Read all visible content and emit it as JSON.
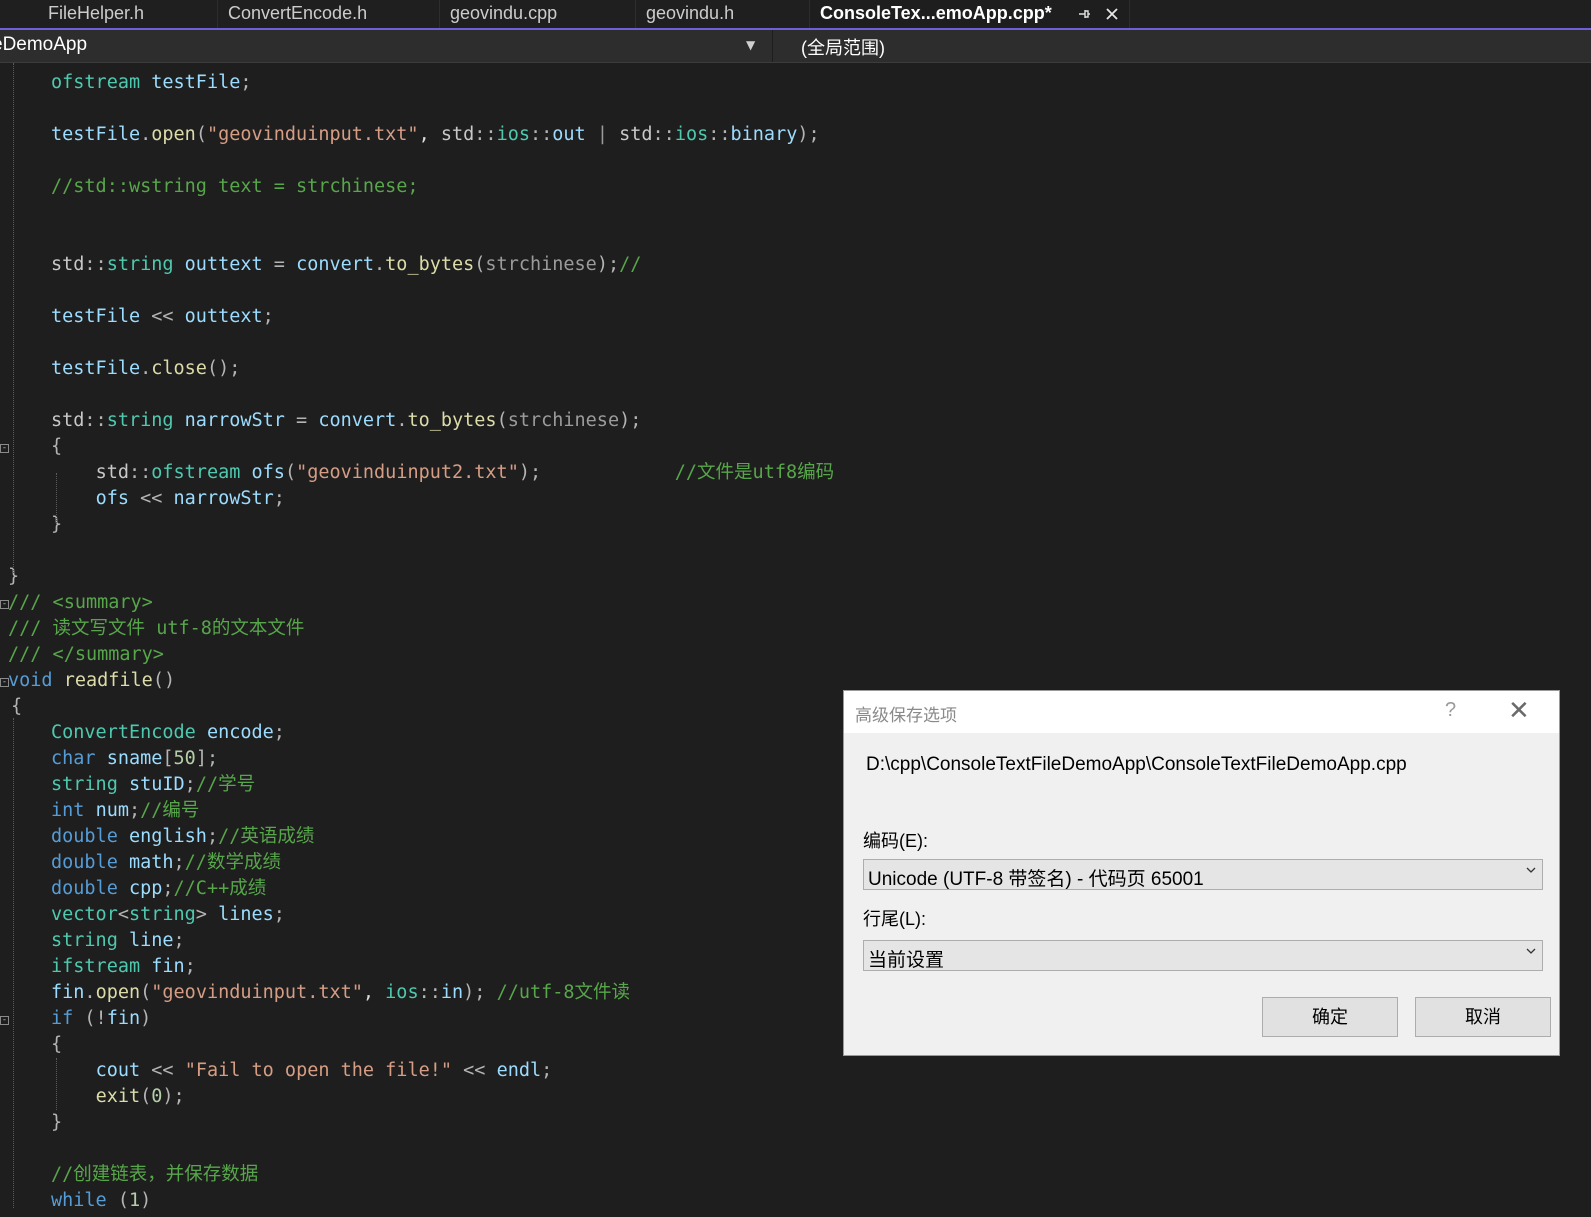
{
  "tabs": [
    {
      "label": "FileHelper.h"
    },
    {
      "label": "ConvertEncode.h"
    },
    {
      "label": "geovindu.cpp"
    },
    {
      "label": "geovindu.h"
    },
    {
      "label": "ConsoleTex...emoApp.cpp*",
      "active": true
    }
  ],
  "tab_icons": {
    "pin": "pin-icon",
    "close": "close-icon"
  },
  "navbar": {
    "project": "eDemoApp",
    "scope": "(全局范围)"
  },
  "code_lines": [
    [
      [
        "ofstream",
        "ty"
      ],
      [
        " ",
        ""
      ],
      [
        "testFile",
        "vr"
      ],
      [
        ";",
        "op"
      ]
    ],
    [],
    [
      [
        "testFile",
        "vr"
      ],
      [
        ".",
        "op"
      ],
      [
        "open",
        "fn"
      ],
      [
        "(",
        "op"
      ],
      [
        "\"geovinduinput.txt\"",
        "st"
      ],
      [
        ", ",
        ""
      ],
      [
        "std",
        "ns"
      ],
      [
        "::",
        "op"
      ],
      [
        "ios",
        "ty"
      ],
      [
        "::",
        "op"
      ],
      [
        "out",
        "vr"
      ],
      [
        " | ",
        "gr"
      ],
      [
        "std",
        "ns"
      ],
      [
        "::",
        "op"
      ],
      [
        "ios",
        "ty"
      ],
      [
        "::",
        "op"
      ],
      [
        "binary",
        "vr"
      ],
      [
        ");",
        "op"
      ]
    ],
    [],
    [
      [
        "//std::wstring text = strchinese;",
        "cm"
      ]
    ],
    [],
    [],
    [
      [
        "std",
        "ns"
      ],
      [
        "::",
        "op"
      ],
      [
        "string",
        "ty"
      ],
      [
        " ",
        ""
      ],
      [
        "outtext",
        "vr"
      ],
      [
        " = ",
        "op"
      ],
      [
        "convert",
        "vr"
      ],
      [
        ".",
        "op"
      ],
      [
        "to_bytes",
        "fn"
      ],
      [
        "(",
        "op"
      ],
      [
        "strchinese",
        "gr"
      ],
      [
        ");",
        "op"
      ],
      [
        "//",
        "cm"
      ]
    ],
    [],
    [
      [
        "testFile",
        "vr"
      ],
      [
        " << ",
        "op"
      ],
      [
        "outtext",
        "vr"
      ],
      [
        ";",
        "op"
      ]
    ],
    [],
    [
      [
        "testFile",
        "vr"
      ],
      [
        ".",
        "op"
      ],
      [
        "close",
        "fn"
      ],
      [
        "();",
        "op"
      ]
    ],
    [],
    [
      [
        "std",
        "ns"
      ],
      [
        "::",
        "op"
      ],
      [
        "string",
        "ty"
      ],
      [
        " ",
        ""
      ],
      [
        "narrowStr",
        "vr"
      ],
      [
        " = ",
        "op"
      ],
      [
        "convert",
        "vr"
      ],
      [
        ".",
        "op"
      ],
      [
        "to_bytes",
        "fn"
      ],
      [
        "(",
        "op"
      ],
      [
        "strchinese",
        "gr"
      ],
      [
        ");",
        "op"
      ]
    ],
    [
      [
        "{",
        "op"
      ]
    ],
    [
      [
        "    ",
        ""
      ],
      [
        "std",
        "ns"
      ],
      [
        "::",
        "op"
      ],
      [
        "ofstream",
        "ty"
      ],
      [
        " ",
        ""
      ],
      [
        "ofs",
        "vr"
      ],
      [
        "(",
        "op"
      ],
      [
        "\"geovinduinput2.txt\"",
        "st"
      ],
      [
        ");",
        "op"
      ],
      [
        "            ",
        ""
      ],
      [
        "//文件是utf8编码",
        "cm"
      ]
    ],
    [
      [
        "    ",
        ""
      ],
      [
        "ofs",
        "vr"
      ],
      [
        " << ",
        "op"
      ],
      [
        "narrowStr",
        "vr"
      ],
      [
        ";",
        "op"
      ]
    ],
    [
      [
        "}",
        "op"
      ]
    ],
    [],
    [
      [
        "}",
        "op"
      ]
    ],
    [
      [
        "/// <summary>",
        "cm"
      ]
    ],
    [
      [
        "/// 读文写文件 utf-8的文本文件",
        "cm"
      ]
    ],
    [
      [
        "/// </summary>",
        "cm"
      ]
    ],
    [
      [
        "void",
        "kw"
      ],
      [
        " ",
        ""
      ],
      [
        "readfile",
        "fn"
      ],
      [
        "()",
        "op"
      ]
    ],
    [
      [
        "{",
        "op"
      ]
    ],
    [
      [
        "ConvertEncode",
        "ty"
      ],
      [
        " ",
        ""
      ],
      [
        "encode",
        "vr"
      ],
      [
        ";",
        "op"
      ]
    ],
    [
      [
        "char",
        "kw"
      ],
      [
        " ",
        ""
      ],
      [
        "sname",
        "vr"
      ],
      [
        "[",
        "op"
      ],
      [
        "50",
        "nm"
      ],
      [
        "];",
        "op"
      ]
    ],
    [
      [
        "string",
        "ty"
      ],
      [
        " ",
        ""
      ],
      [
        "stuID",
        "vr"
      ],
      [
        ";",
        "op"
      ],
      [
        "//学号",
        "cm"
      ]
    ],
    [
      [
        "int",
        "kw"
      ],
      [
        " ",
        ""
      ],
      [
        "num",
        "vr"
      ],
      [
        ";",
        "op"
      ],
      [
        "//编号",
        "cm"
      ]
    ],
    [
      [
        "double",
        "kw"
      ],
      [
        " ",
        ""
      ],
      [
        "english",
        "vr"
      ],
      [
        ";",
        "op"
      ],
      [
        "//英语成绩",
        "cm"
      ]
    ],
    [
      [
        "double",
        "kw"
      ],
      [
        " ",
        ""
      ],
      [
        "math",
        "vr"
      ],
      [
        ";",
        "op"
      ],
      [
        "//数学成绩",
        "cm"
      ]
    ],
    [
      [
        "double",
        "kw"
      ],
      [
        " ",
        ""
      ],
      [
        "cpp",
        "vr"
      ],
      [
        ";",
        "op"
      ],
      [
        "//C++成绩",
        "cm"
      ]
    ],
    [
      [
        "vector",
        "ty"
      ],
      [
        "<",
        "op"
      ],
      [
        "string",
        "ty"
      ],
      [
        "> ",
        "op"
      ],
      [
        "lines",
        "vr"
      ],
      [
        ";",
        "op"
      ]
    ],
    [
      [
        "string",
        "ty"
      ],
      [
        " ",
        ""
      ],
      [
        "line",
        "vr"
      ],
      [
        ";",
        "op"
      ]
    ],
    [
      [
        "ifstream",
        "ty"
      ],
      [
        " ",
        ""
      ],
      [
        "fin",
        "vr"
      ],
      [
        ";",
        "op"
      ]
    ],
    [
      [
        "fin",
        "vr"
      ],
      [
        ".",
        "op"
      ],
      [
        "open",
        "fn"
      ],
      [
        "(",
        "op"
      ],
      [
        "\"geovinduinput.txt\"",
        "st"
      ],
      [
        ", ",
        ""
      ],
      [
        "ios",
        "ty"
      ],
      [
        "::",
        "op"
      ],
      [
        "in",
        "vr"
      ],
      [
        "); ",
        "op"
      ],
      [
        "//utf-8文件读",
        "cm"
      ]
    ],
    [
      [
        "if",
        "kw"
      ],
      [
        " (!",
        "op"
      ],
      [
        "fin",
        "vr"
      ],
      [
        ")",
        "op"
      ]
    ],
    [
      [
        "{",
        "op"
      ]
    ],
    [
      [
        "    ",
        ""
      ],
      [
        "cout",
        "vr"
      ],
      [
        " << ",
        "op"
      ],
      [
        "\"Fail to open the file!\"",
        "st"
      ],
      [
        " << ",
        "op"
      ],
      [
        "endl",
        "vr"
      ],
      [
        ";",
        "op"
      ]
    ],
    [
      [
        "    ",
        ""
      ],
      [
        "exit",
        "fn"
      ],
      [
        "(",
        "op"
      ],
      [
        "0",
        "nm"
      ],
      [
        ");",
        "op"
      ]
    ],
    [
      [
        "}",
        "op"
      ]
    ],
    [],
    [
      [
        "//创建链表，并保存数据",
        "cm"
      ]
    ],
    [
      [
        "while",
        "kw"
      ],
      [
        " (",
        "op"
      ],
      [
        "1",
        "nm"
      ],
      [
        ")",
        "op"
      ]
    ]
  ],
  "dialog": {
    "title": "高级保存选项",
    "help_label": "?",
    "close_label": "✕",
    "file_path": "D:\\cpp\\ConsoleTextFileDemoApp\\ConsoleTextFileDemoApp.cpp",
    "encoding_label": "编码(E):",
    "encoding_value": "Unicode (UTF-8 带签名) - 代码页 65001",
    "line_ending_label": "行尾(L):",
    "line_ending_value": "当前设置",
    "ok_label": "确定",
    "cancel_label": "取消"
  },
  "colors": {
    "editor_bg": "#1e1e1e",
    "tab_accent": "#6f5fd6",
    "dialog_bg": "#f0f0f0"
  }
}
